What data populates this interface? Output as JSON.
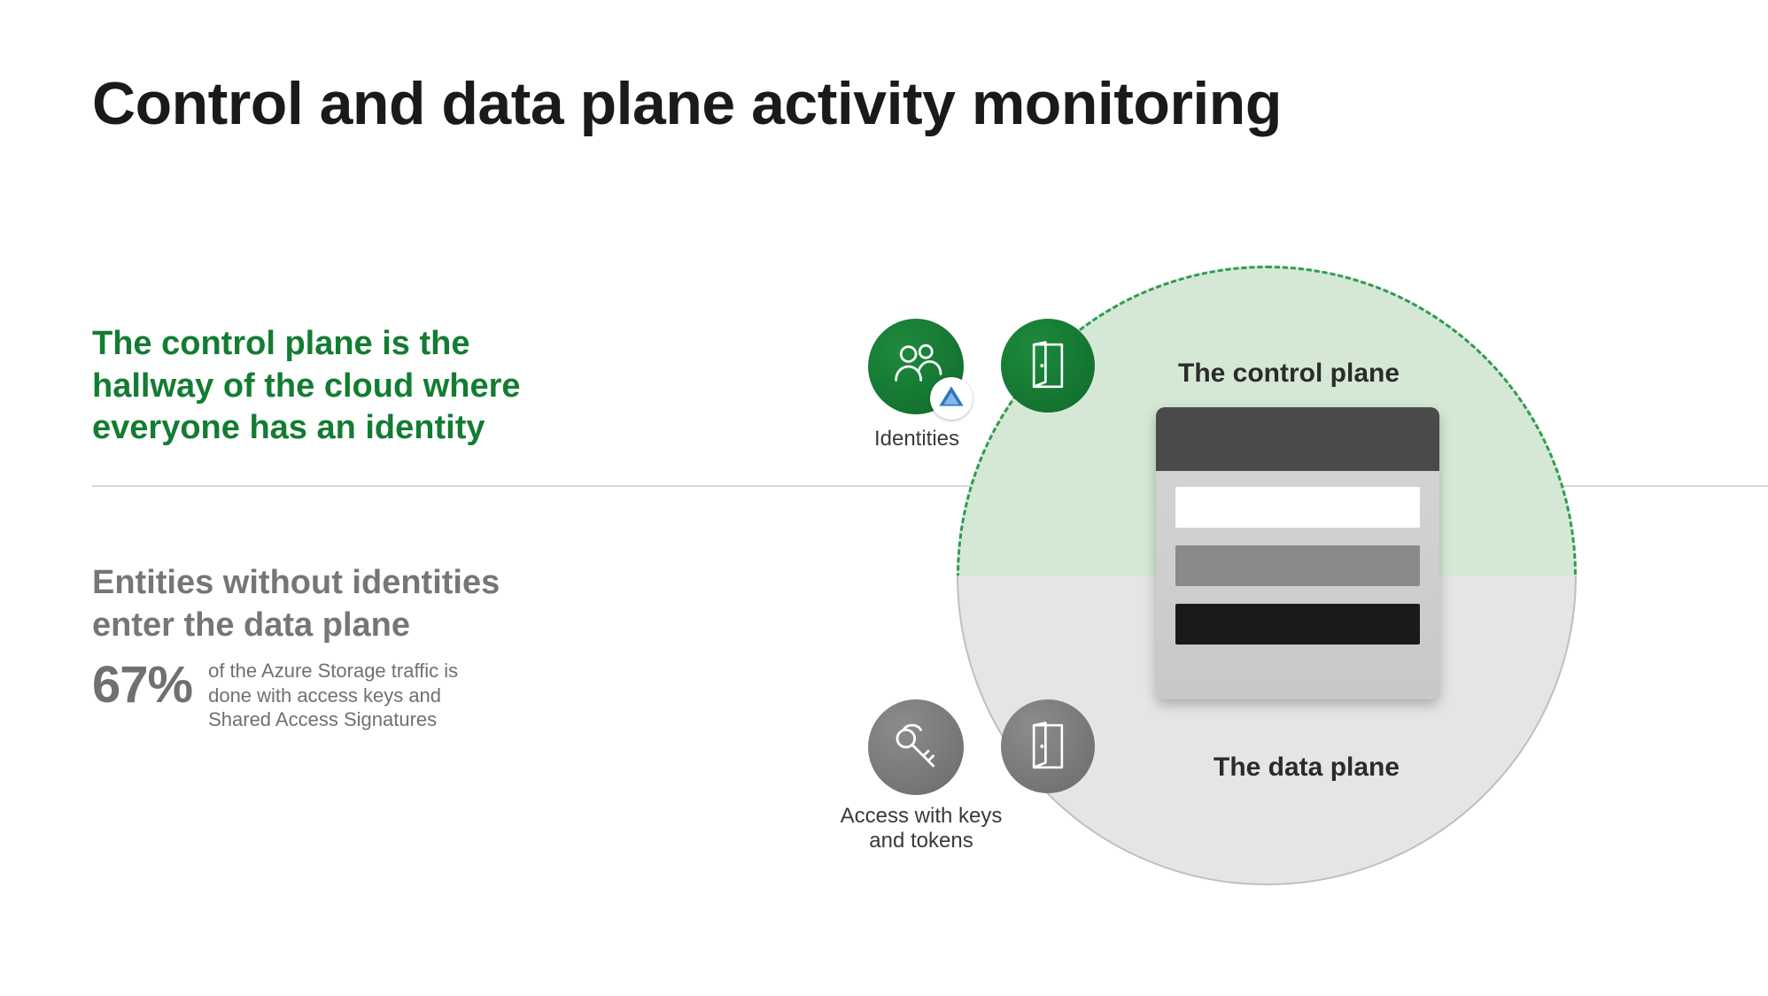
{
  "title": "Control and data plane activity monitoring",
  "top_section": {
    "text": "The control plane is the hallway of the cloud where everyone has an identity"
  },
  "bottom_section": {
    "text": "Entities without identities enter the data plane",
    "stat_value": "67%",
    "stat_desc": "of the Azure Storage traffic is done with access keys and Shared Access Signatures"
  },
  "diagram": {
    "control_plane_label": "The control plane",
    "data_plane_label": "The data plane",
    "identities_caption": "Identities",
    "keys_caption": "Access with keys and tokens"
  },
  "colors": {
    "accent_green": "#137c32",
    "muted_gray": "#767676"
  }
}
